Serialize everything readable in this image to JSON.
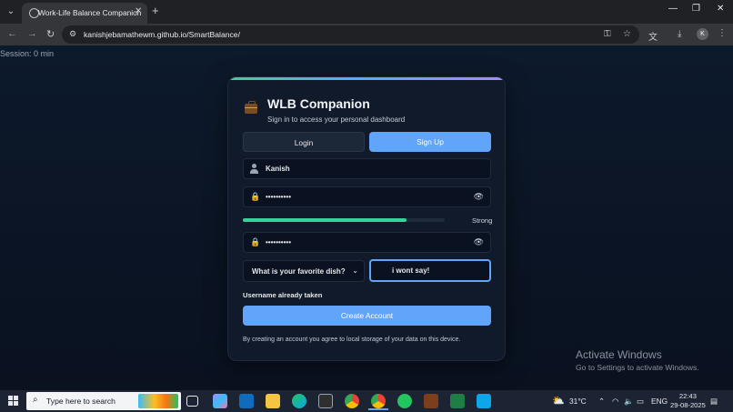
{
  "browser": {
    "tab_title": "Work-Life Balance Companion",
    "url": "kanishjebamathewm.github.io/SmartBalance/",
    "profile_initial": "K"
  },
  "page": {
    "session": "Session: 0 min",
    "card": {
      "title": "WLB Companion",
      "subtitle": "Sign in to access your personal dashboard",
      "tabs": [
        "Login",
        "Sign Up"
      ],
      "active_tab": "Sign Up",
      "username": "Kanish",
      "password_masked": "••••••••••",
      "strength_label": "Strong",
      "strength_fraction": 0.81,
      "confirm_masked": "••••••••••",
      "security_question": "What is your favorite dish?",
      "security_answer": "i wont say!",
      "error": "Username already taken",
      "create_label": "Create Account",
      "terms": "By creating an account you agree to local storage of your data on this device."
    }
  },
  "watermark": {
    "title": "Activate Windows",
    "subtitle": "Go to Settings to activate Windows."
  },
  "taskbar": {
    "search_placeholder": "Type here to search",
    "weather": "31°C",
    "language": "ENG",
    "time": "22:43",
    "date": "29-08-2025"
  },
  "colors": {
    "accent": "#60a5fa",
    "success": "#34d399",
    "card_bg": "#111a2a"
  }
}
